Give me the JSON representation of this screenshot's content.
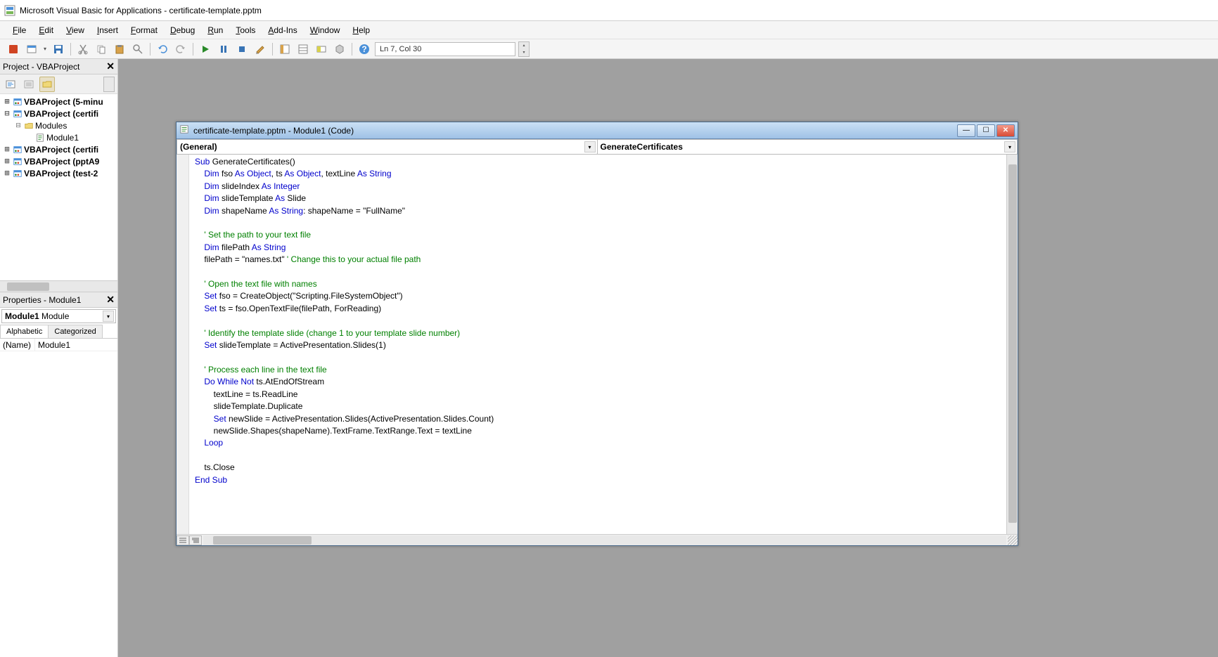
{
  "titlebar": {
    "text": "Microsoft Visual Basic for Applications - certificate-template.pptm"
  },
  "menus": [
    "File",
    "Edit",
    "View",
    "Insert",
    "Format",
    "Debug",
    "Run",
    "Tools",
    "Add-Ins",
    "Window",
    "Help"
  ],
  "toolbar": {
    "position": "Ln 7, Col 30"
  },
  "project_panel": {
    "title": "Project - VBAProject",
    "tree": [
      {
        "depth": 0,
        "bold": true,
        "icon": "vba-project-icon",
        "label": "VBAProject (5-minu"
      },
      {
        "depth": 0,
        "bold": true,
        "icon": "vba-project-icon",
        "label": "VBAProject (certifi",
        "twist": "-"
      },
      {
        "depth": 1,
        "bold": false,
        "icon": "folder-icon",
        "label": "Modules",
        "twist": "-"
      },
      {
        "depth": 2,
        "bold": false,
        "icon": "module-icon",
        "label": "Module1"
      },
      {
        "depth": 0,
        "bold": true,
        "icon": "vba-project-icon",
        "label": "VBAProject (certifi"
      },
      {
        "depth": 0,
        "bold": true,
        "icon": "vba-project-icon",
        "label": "VBAProject (pptA9"
      },
      {
        "depth": 0,
        "bold": true,
        "icon": "vba-project-icon",
        "label": "VBAProject (test-2"
      }
    ]
  },
  "properties_panel": {
    "title": "Properties - Module1",
    "combo_bold": "Module1",
    "combo_rest": " Module",
    "tabs": [
      "Alphabetic",
      "Categorized"
    ],
    "rows": [
      {
        "k": "(Name)",
        "v": "Module1"
      }
    ]
  },
  "code_window": {
    "title": "certificate-template.pptm - Module1 (Code)",
    "left_combo": "(General)",
    "right_combo": "GenerateCertificates",
    "code_tokens": [
      [
        {
          "t": "Sub ",
          "c": "kw"
        },
        {
          "t": "GenerateCertificates()"
        }
      ],
      [
        {
          "t": "    "
        },
        {
          "t": "Dim ",
          "c": "kw"
        },
        {
          "t": "fso "
        },
        {
          "t": "As Object",
          "c": "kw"
        },
        {
          "t": ", ts "
        },
        {
          "t": "As Object",
          "c": "kw"
        },
        {
          "t": ", textLine "
        },
        {
          "t": "As String",
          "c": "kw"
        }
      ],
      [
        {
          "t": "    "
        },
        {
          "t": "Dim ",
          "c": "kw"
        },
        {
          "t": "slideIndex "
        },
        {
          "t": "As Integer",
          "c": "kw"
        }
      ],
      [
        {
          "t": "    "
        },
        {
          "t": "Dim ",
          "c": "kw"
        },
        {
          "t": "slideTemplate "
        },
        {
          "t": "As ",
          "c": "kw"
        },
        {
          "t": "Slide"
        }
      ],
      [
        {
          "t": "    "
        },
        {
          "t": "Dim ",
          "c": "kw"
        },
        {
          "t": "shapeName "
        },
        {
          "t": "As String",
          "c": "kw"
        },
        {
          "t": ": shapeName = \"FullName\""
        }
      ],
      [
        {
          "t": ""
        }
      ],
      [
        {
          "t": "    "
        },
        {
          "t": "' Set the path to your text file",
          "c": "cm"
        }
      ],
      [
        {
          "t": "    "
        },
        {
          "t": "Dim ",
          "c": "kw"
        },
        {
          "t": "filePath "
        },
        {
          "t": "As String",
          "c": "kw"
        }
      ],
      [
        {
          "t": "    filePath = \"names.txt\" "
        },
        {
          "t": "' Change this to your actual file path",
          "c": "cm"
        }
      ],
      [
        {
          "t": ""
        }
      ],
      [
        {
          "t": "    "
        },
        {
          "t": "' Open the text file with names",
          "c": "cm"
        }
      ],
      [
        {
          "t": "    "
        },
        {
          "t": "Set ",
          "c": "kw"
        },
        {
          "t": "fso = CreateObject(\"Scripting.FileSystemObject\")"
        }
      ],
      [
        {
          "t": "    "
        },
        {
          "t": "Set ",
          "c": "kw"
        },
        {
          "t": "ts = fso.OpenTextFile(filePath, ForReading)"
        }
      ],
      [
        {
          "t": ""
        }
      ],
      [
        {
          "t": "    "
        },
        {
          "t": "' Identify the template slide (change 1 to your template slide number)",
          "c": "cm"
        }
      ],
      [
        {
          "t": "    "
        },
        {
          "t": "Set ",
          "c": "kw"
        },
        {
          "t": "slideTemplate = ActivePresentation.Slides(1)"
        }
      ],
      [
        {
          "t": ""
        }
      ],
      [
        {
          "t": "    "
        },
        {
          "t": "' Process each line in the text file",
          "c": "cm"
        }
      ],
      [
        {
          "t": "    "
        },
        {
          "t": "Do While Not ",
          "c": "kw"
        },
        {
          "t": "ts.AtEndOfStream"
        }
      ],
      [
        {
          "t": "        textLine = ts.ReadLine"
        }
      ],
      [
        {
          "t": "        slideTemplate.Duplicate"
        }
      ],
      [
        {
          "t": "        "
        },
        {
          "t": "Set ",
          "c": "kw"
        },
        {
          "t": "newSlide = ActivePresentation.Slides(ActivePresentation.Slides.Count)"
        }
      ],
      [
        {
          "t": "        newSlide.Shapes(shapeName).TextFrame.TextRange.Text = textLine"
        }
      ],
      [
        {
          "t": "    "
        },
        {
          "t": "Loop",
          "c": "kw"
        }
      ],
      [
        {
          "t": ""
        }
      ],
      [
        {
          "t": "    ts.Close"
        }
      ],
      [
        {
          "t": "End Sub",
          "c": "kw"
        }
      ]
    ]
  }
}
